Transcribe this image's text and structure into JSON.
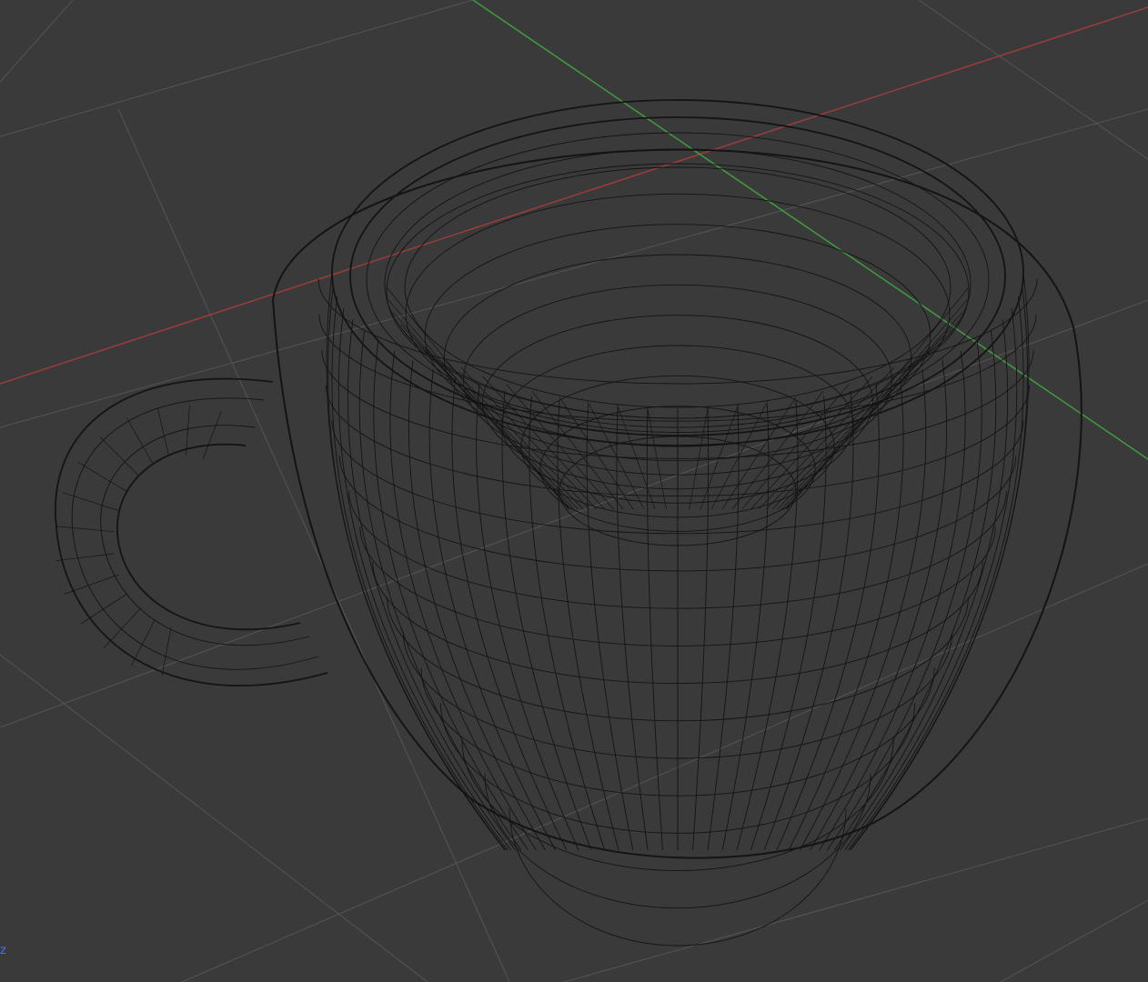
{
  "viewport": {
    "mode": "wireframe",
    "object_icon": "cup-wireframe-icon",
    "colors": {
      "background": "#3a3a3a",
      "grid": "#555555",
      "x_axis": "#9c3c3c",
      "y_axis": "#3f9c3f",
      "wire": "#141414"
    },
    "axis_hint_label": "z"
  }
}
